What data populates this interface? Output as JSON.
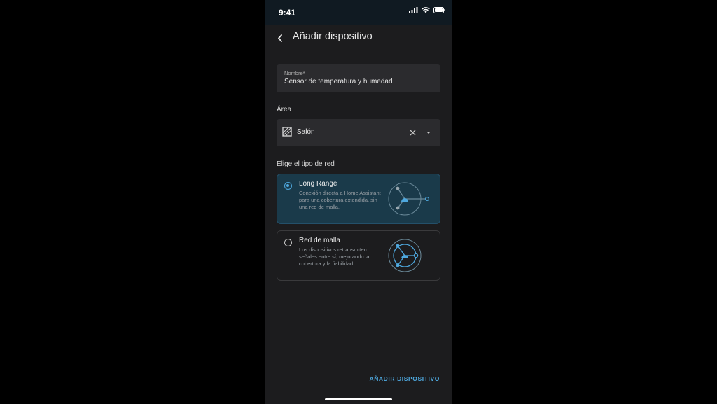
{
  "status_bar": {
    "time": "9:41"
  },
  "header": {
    "title": "Añadir dispositivo"
  },
  "form": {
    "name_label": "Nombre*",
    "name_value": "Sensor de temperatura y humedad",
    "area_label": "Área",
    "area_value": "Salón",
    "network_label": "Elige el tipo de red",
    "options": [
      {
        "title": "Long Range",
        "description": "Conexión directa a Home Assistant para una cobertura extendida, sin una red de malla.",
        "selected": true
      },
      {
        "title": "Red de malla",
        "description": "Los dispositivos retransmiten señales entre sí, mejorando la cobertura y la fiabilidad.",
        "selected": false
      }
    ]
  },
  "actions": {
    "submit_label": "AÑADIR DISPOSITIVO"
  },
  "colors": {
    "accent": "#4ea8de",
    "background": "#1c1c1e",
    "selected_card": "#1a3a4a",
    "status_bar": "#101a22"
  },
  "icons": {
    "back": "chevron-left-icon",
    "area": "area-hatch-icon",
    "clear": "close-icon",
    "dropdown": "triangle-down-icon"
  }
}
